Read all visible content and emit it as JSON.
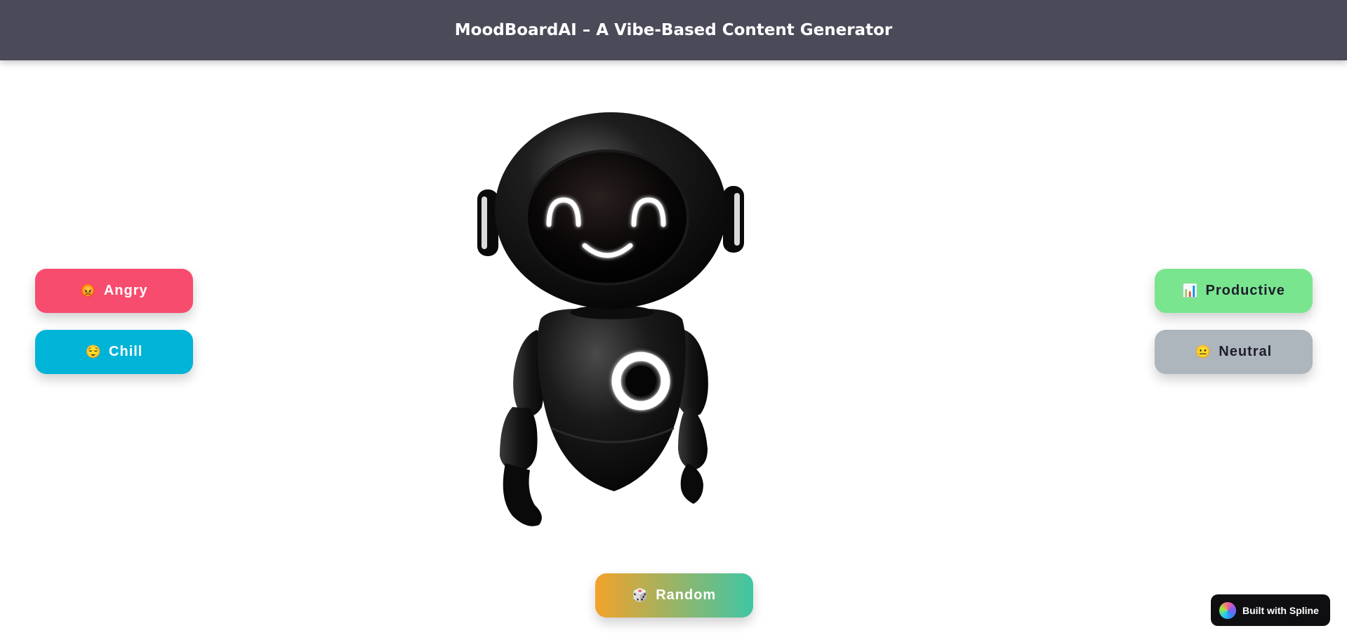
{
  "header": {
    "title": "MoodBoardAI – A Vibe-Based Content Generator"
  },
  "moods": {
    "angry": {
      "emoji": "😡",
      "label": "Angry"
    },
    "chill": {
      "emoji": "😌",
      "label": "Chill"
    },
    "productive": {
      "emoji": "📊",
      "label": "Productive"
    },
    "neutral": {
      "emoji": "😐",
      "label": "Neutral"
    },
    "random": {
      "emoji": "🎲",
      "label": "Random"
    }
  },
  "colors": {
    "header_bg": "#4a4a59",
    "angry": "#f74c6e",
    "chill": "#00b4d8",
    "productive": "#7ae58f",
    "neutral": "#adb5bd",
    "random_start": "#f2a22a",
    "random_end": "#3fc6a5"
  },
  "badge": {
    "label": "Built with Spline"
  }
}
